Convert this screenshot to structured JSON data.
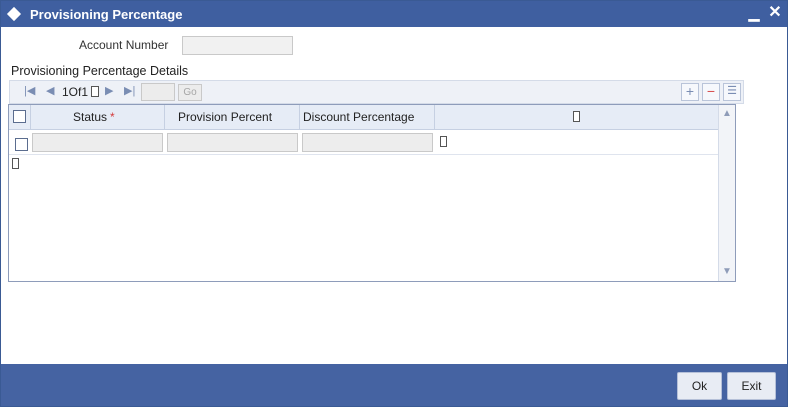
{
  "window": {
    "title": "Provisioning Percentage",
    "minimize_glyph": "▁",
    "close_glyph": "✕",
    "title_icon": "diamond-icon"
  },
  "form": {
    "account_number_label": "Account Number",
    "account_number_value": ""
  },
  "section": {
    "title": "Provisioning Percentage Details"
  },
  "pager": {
    "first_icon": "first-page-icon",
    "prev_icon": "prev-page-icon",
    "next_icon": "next-page-icon",
    "last_icon": "last-page-icon",
    "page_info": "1Of1",
    "page_input_value": "",
    "go_label": "Go",
    "add_icon": "add-row-icon",
    "delete_icon": "delete-row-icon",
    "columns_icon": "columns-icon"
  },
  "grid": {
    "columns": [
      {
        "label": "Status",
        "required": true
      },
      {
        "label": "Provision Percent",
        "required": false
      },
      {
        "label": "Discount Percentage",
        "required": false
      }
    ],
    "required_marker": "*",
    "rows": [
      {
        "status": "",
        "provision_percent": "",
        "discount_percentage": ""
      }
    ]
  },
  "footer": {
    "ok_label": "Ok",
    "exit_label": "Exit"
  },
  "colors": {
    "titlebar": "#3f5fa0",
    "footer": "#4563a2",
    "grid_header": "#e6ecf6"
  }
}
